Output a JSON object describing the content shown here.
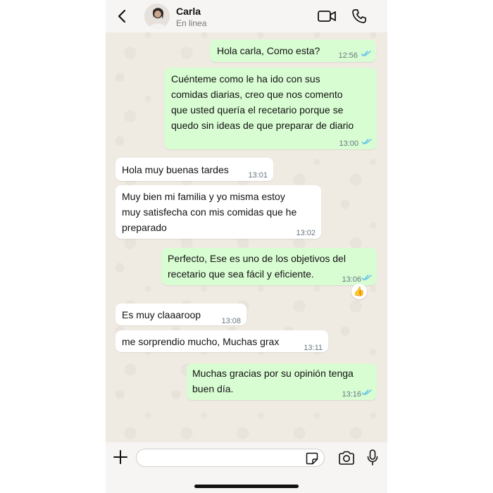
{
  "header": {
    "contact_name": "Carla",
    "status": "En linea",
    "back_icon": "chevron-left-icon",
    "video_icon": "video-camera-icon",
    "call_icon": "phone-icon"
  },
  "messages": [
    {
      "direction": "outgoing",
      "lines": [
        "Hola carla, Como esta?"
      ],
      "time": "12:56",
      "read": true
    },
    {
      "direction": "outgoing",
      "lines": [
        "Cuénteme como le ha ido con sus",
        "comidas diarias, creo que nos comento",
        "que usted quería el recetario porque se",
        "quedo sin ideas de que preparar de diario"
      ],
      "time": "13:00",
      "read": true
    },
    {
      "direction": "incoming",
      "lines": [
        "Hola muy buenas tardes"
      ],
      "time": "13:01"
    },
    {
      "direction": "incoming",
      "lines": [
        "Muy bien mi familia y yo misma estoy",
        "muy satisfecha con mis comidas que he",
        "preparado"
      ],
      "time": "13:02"
    },
    {
      "direction": "outgoing",
      "lines": [
        "Perfecto, Ese es uno de los objetivos del",
        "recetario que sea fácil y eficiente."
      ],
      "time": "13:06",
      "read": true,
      "reaction": "👍"
    },
    {
      "direction": "incoming",
      "lines": [
        "Es muy claaaroop"
      ],
      "time": "13:08"
    },
    {
      "direction": "incoming",
      "lines": [
        "me sorprendio mucho, Muchas grax"
      ],
      "time": "13:11"
    },
    {
      "direction": "outgoing",
      "lines": [
        "Muchas gracias por su opinión tenga",
        "buen día."
      ],
      "time": "13:16",
      "read": true
    }
  ],
  "composer": {
    "input_value": "",
    "plus_icon": "plus-icon",
    "sticker_icon": "sticker-icon",
    "camera_icon": "camera-icon",
    "mic_icon": "microphone-icon"
  },
  "colors": {
    "outgoing_bubble": "#d9fdd3",
    "incoming_bubble": "#ffffff",
    "chat_background": "#efeae2",
    "read_ticks": "#53bdeb"
  }
}
